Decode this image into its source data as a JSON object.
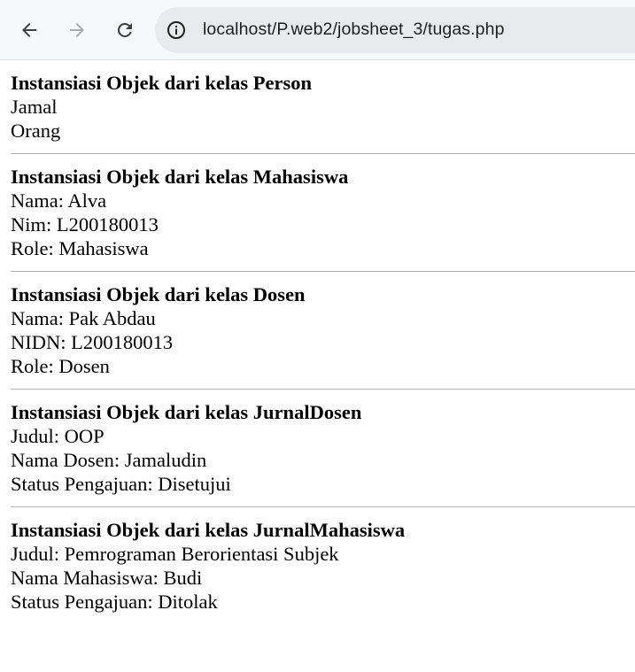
{
  "browser": {
    "url": "localhost/P.web2/jobsheet_3/tugas.php"
  },
  "sections": [
    {
      "title": "Instansiasi Objek dari kelas Person",
      "lines": [
        "Jamal",
        "Orang"
      ]
    },
    {
      "title": "Instansiasi Objek dari kelas Mahasiswa",
      "lines": [
        "Nama: Alva",
        "Nim: L200180013",
        "Role: Mahasiswa"
      ]
    },
    {
      "title": "Instansiasi Objek dari kelas Dosen",
      "lines": [
        "Nama: Pak Abdau",
        "NIDN: L200180013",
        "Role: Dosen"
      ]
    },
    {
      "title": "Instansiasi Objek dari kelas JurnalDosen",
      "lines": [
        "Judul: OOP",
        "Nama Dosen: Jamaludin",
        "Status Pengajuan: Disetujui"
      ]
    },
    {
      "title": "Instansiasi Objek dari kelas JurnalMahasiswa",
      "lines": [
        "Judul: Pemrograman Berorientasi Subjek",
        "Nama Mahasiswa: Budi",
        "Status Pengajuan: Ditolak"
      ]
    }
  ]
}
